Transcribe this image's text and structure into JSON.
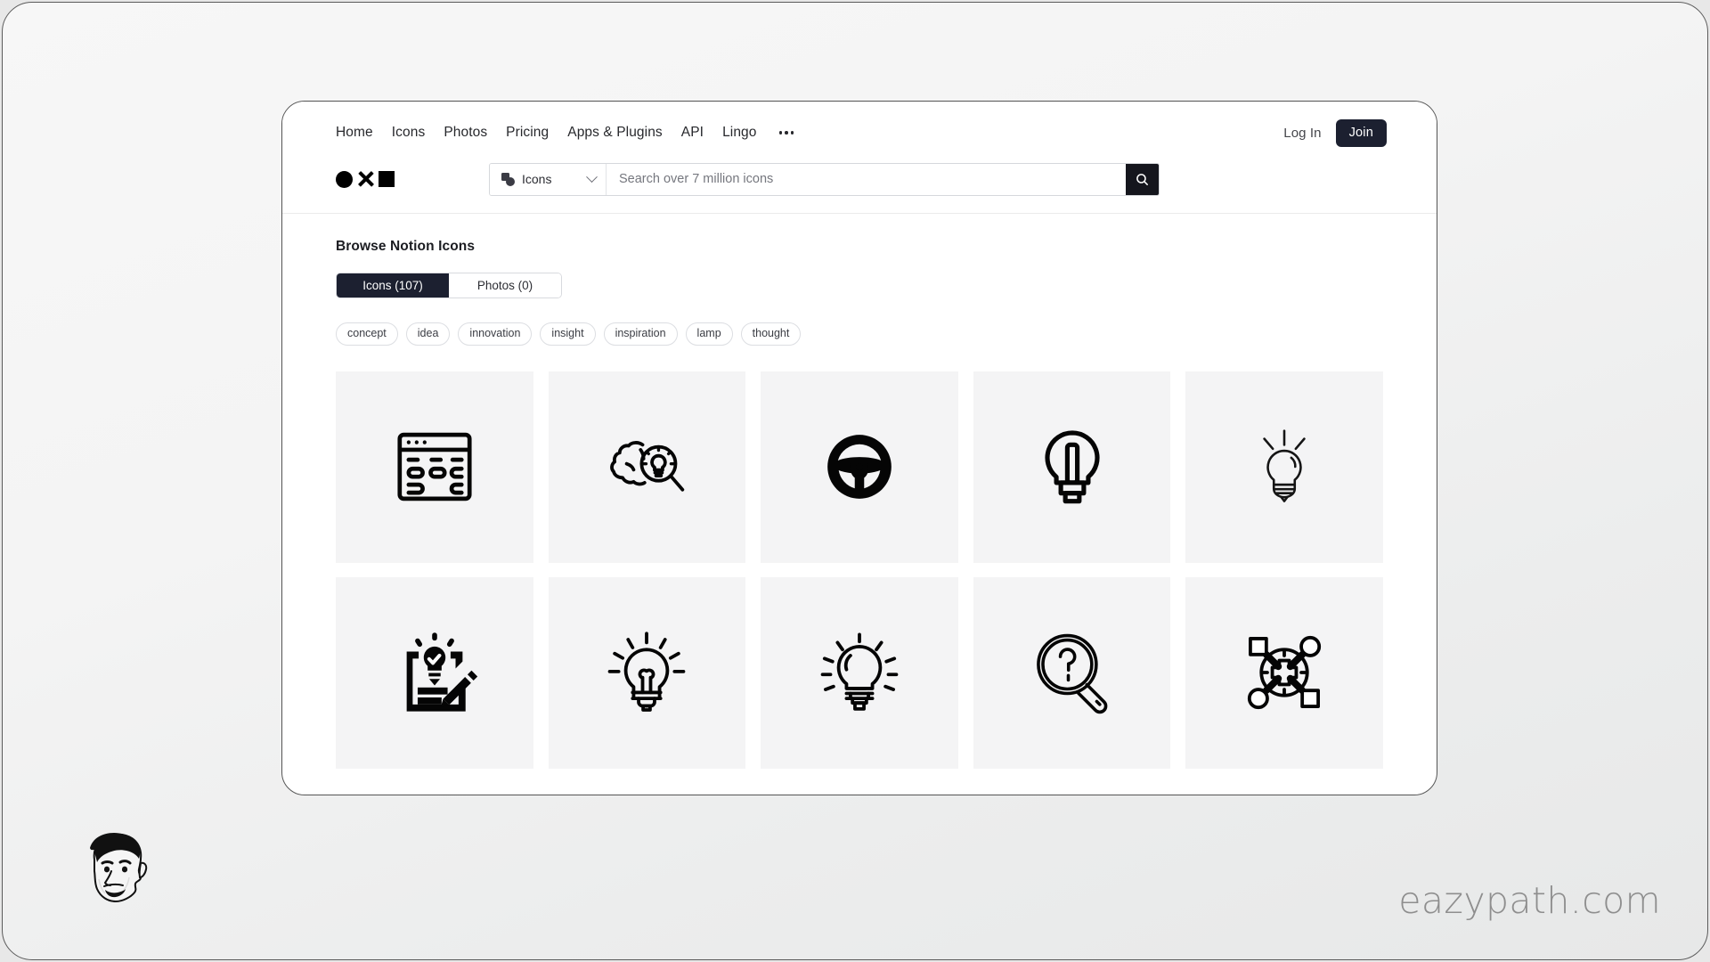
{
  "header": {
    "nav": [
      {
        "label": "Home",
        "name": "nav-link-home"
      },
      {
        "label": "Icons",
        "name": "nav-link-icons"
      },
      {
        "label": "Photos",
        "name": "nav-link-photos"
      },
      {
        "label": "Pricing",
        "name": "nav-link-pricing"
      },
      {
        "label": "Apps & Plugins",
        "name": "nav-link-apps-plugins"
      },
      {
        "label": "API",
        "name": "nav-link-api"
      },
      {
        "label": "Lingo",
        "name": "nav-link-lingo"
      }
    ],
    "more_icon": "ellipsis-icon",
    "login_label": "Log In",
    "join_label": "Join",
    "join_bg_color": "#1c2030",
    "logo": {
      "shapes": [
        "circle",
        "x",
        "square"
      ],
      "color": "#000000"
    }
  },
  "search": {
    "type_label": "Icons",
    "type_icon": "shapes-icon",
    "chevron_icon": "chevron-down-icon",
    "placeholder": "Search over 7 million icons",
    "value": "",
    "submit_icon": "search-icon",
    "submit_bg_color": "#15161d"
  },
  "main": {
    "title": "Browse Notion Icons",
    "tabs": [
      {
        "label": "Icons (107)",
        "active": true,
        "name": "tab-icons"
      },
      {
        "label": "Photos (0)",
        "active": false,
        "name": "tab-photos"
      }
    ],
    "tags": [
      "concept",
      "idea",
      "innovation",
      "insight",
      "inspiration",
      "lamp",
      "thought"
    ],
    "tiles": [
      {
        "icon": "browser-wireframe-icon",
        "label": "browser wireframe"
      },
      {
        "icon": "brain-magnifier-bulb-icon",
        "label": "brain with magnifier and bulb"
      },
      {
        "icon": "steering-wheel-icon",
        "label": "steering wheel"
      },
      {
        "icon": "lightbulb-filament-solid-icon",
        "label": "lightbulb with filament"
      },
      {
        "icon": "lightbulb-rays-thin-icon",
        "label": "lightbulb with rays"
      },
      {
        "icon": "clipboard-bulb-pencil-icon",
        "label": "clipboard with bulb and pencil"
      },
      {
        "icon": "lightbulb-rays-filament-icon",
        "label": "lightbulb rays filament"
      },
      {
        "icon": "lightbulb-rays-ridged-icon",
        "label": "lightbulb rays ridged base"
      },
      {
        "icon": "magnifier-question-icon",
        "label": "magnifier with question mark"
      },
      {
        "icon": "network-hub-nodes-icon",
        "label": "network hub nodes"
      }
    ]
  },
  "overlay": {
    "watermark": "eazypath.com",
    "watermark_color": "#8e8e8e",
    "avatar_icon": "avatar-face-illustration"
  }
}
